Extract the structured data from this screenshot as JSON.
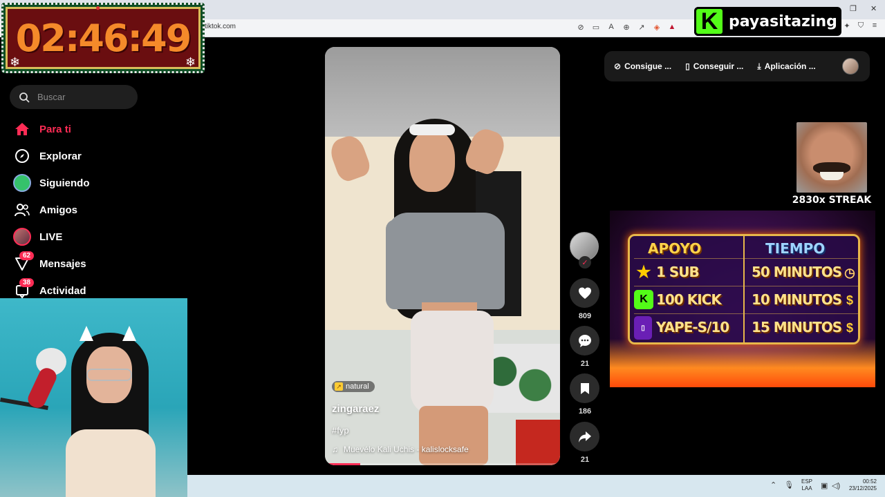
{
  "browser": {
    "url": "tiktok.com",
    "window_controls": {
      "minimize": "–",
      "restore": "❐",
      "close": "✕"
    }
  },
  "stream_overlay": {
    "timer": "02:46:49",
    "kick_channel": "payasitazing",
    "kick_logo_letter": "K",
    "brand_color": "#53fc18",
    "streak": "2830x STREAK",
    "support": {
      "header_left": "APOYO",
      "header_right": "TIEMPO",
      "rows": [
        {
          "icon": "star-icon",
          "left": "1 SUB",
          "right": "50 MINUTOS"
        },
        {
          "icon": "kick-icon",
          "left": "100 KICK",
          "right": "10 MINUTOS"
        },
        {
          "icon": "phone-icon",
          "left": "YAPE-S/10",
          "right": "15 MINUTOS"
        }
      ]
    }
  },
  "sidebar": {
    "search_placeholder": "Buscar",
    "items": [
      {
        "label": "Para ti",
        "icon": "home-icon",
        "active": true
      },
      {
        "label": "Explorar",
        "icon": "compass-icon"
      },
      {
        "label": "Siguiendo",
        "icon": "following-avatar-icon"
      },
      {
        "label": "Amigos",
        "icon": "friends-icon"
      },
      {
        "label": "LIVE",
        "icon": "live-avatar-icon"
      },
      {
        "label": "Mensajes",
        "icon": "messages-icon",
        "badge": "62"
      },
      {
        "label": "Actividad",
        "icon": "activity-icon",
        "badge": "38"
      }
    ]
  },
  "top_actions": [
    {
      "label": "Consigue ...",
      "icon": "coin-icon"
    },
    {
      "label": "Conseguir ...",
      "icon": "phone-icon"
    },
    {
      "label": "Aplicación ...",
      "icon": "download-icon"
    }
  ],
  "video": {
    "sticker": "natural",
    "username": "zingaraez",
    "hashtag": "#fyp",
    "music": "Muevélo Kali Uchis - kalislocksafe",
    "progress": 0.15,
    "accent": "#fe2c55"
  },
  "actions": {
    "likes": "809",
    "comments": "21",
    "saves": "186",
    "shares": "21"
  },
  "taskbar": {
    "lang_line1": "ESP",
    "lang_line2": "LAA",
    "time": "00:52",
    "date": "23/12/2025"
  }
}
